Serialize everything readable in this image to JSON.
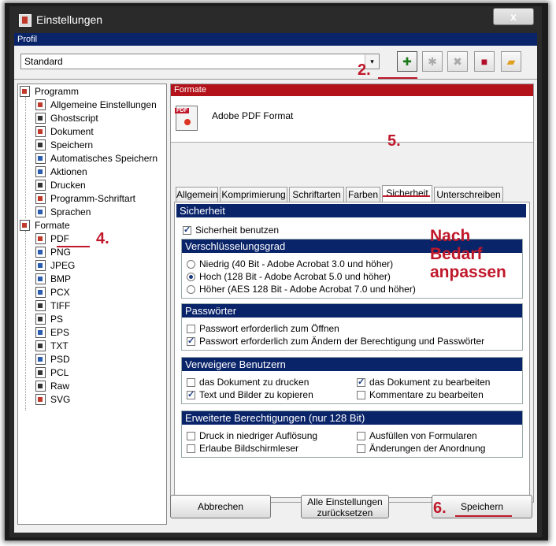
{
  "window": {
    "title": "Einstellungen",
    "close_label": "x"
  },
  "profil": {
    "header": "Profil",
    "selected": "Standard",
    "dropdown_arrow": "▾"
  },
  "toolbar": {
    "add_icon": "add-profile-icon",
    "rename_icon": "rename-profile-icon",
    "delete_icon": "delete-profile-icon",
    "save_icon": "save-profile-icon",
    "open_icon": "open-folder-icon"
  },
  "annotations": {
    "a2": "2.",
    "a4": "4.",
    "a5": "5.",
    "a6": "6.",
    "nach": "Nach",
    "bedarf": "Bedarf",
    "anpassen": "anpassen"
  },
  "tree": {
    "programm": "Programm",
    "programm_items": [
      "Allgemeine Einstellungen",
      "Ghostscript",
      "Dokument",
      "Speichern",
      "Automatisches Speichern",
      "Aktionen",
      "Drucken",
      "Programm-Schriftart",
      "Sprachen"
    ],
    "formate": "Formate",
    "formate_items": [
      "PDF",
      "PNG",
      "JPEG",
      "BMP",
      "PCX",
      "TIFF",
      "PS",
      "EPS",
      "TXT",
      "PSD",
      "PCL",
      "Raw",
      "SVG"
    ]
  },
  "format_panel": {
    "header": "Formate",
    "name": "Adobe PDF Format"
  },
  "tabs": [
    "Allgemein",
    "Komprimierung",
    "Schriftarten",
    "Farben",
    "Sicherheit",
    "Unterschreiben"
  ],
  "active_tab": "Sicherheit",
  "security": {
    "header": "Sicherheit",
    "use_security": "Sicherheit benutzen",
    "encryption": {
      "header": "Verschlüsselungsgrad",
      "options": [
        "Niedrig (40 Bit - Adobe Acrobat 3.0 und höher)",
        "Hoch (128 Bit - Adobe Acrobat 5.0 und höher)",
        "Höher (AES 128 Bit - Adobe Acrobat 7.0 und höher)"
      ],
      "selected_index": 1
    },
    "passwords": {
      "header": "Passwörter",
      "open": "Passwort erforderlich zum Öffnen",
      "change": "Passwort erforderlich zum Ändern der Berechtigung und Passwörter"
    },
    "deny": {
      "header": "Verweigere Benutzern",
      "print": "das Dokument zu drucken",
      "edit": "das Dokument zu bearbeiten",
      "copy": "Text und Bilder zu kopieren",
      "comments": "Kommentare zu bearbeiten"
    },
    "extended": {
      "header": "Erweiterte Berechtigungen (nur 128 Bit)",
      "lowres": "Druck in niedriger Auflösung",
      "forms": "Ausfüllen von Formularen",
      "reader": "Erlaube Bildschirmleser",
      "assembly": "Änderungen der Anordnung"
    }
  },
  "buttons": {
    "cancel": "Abbrechen",
    "reset_line1": "Alle Einstellungen",
    "reset_line2": "zurücksetzen",
    "save": "Speichern"
  }
}
